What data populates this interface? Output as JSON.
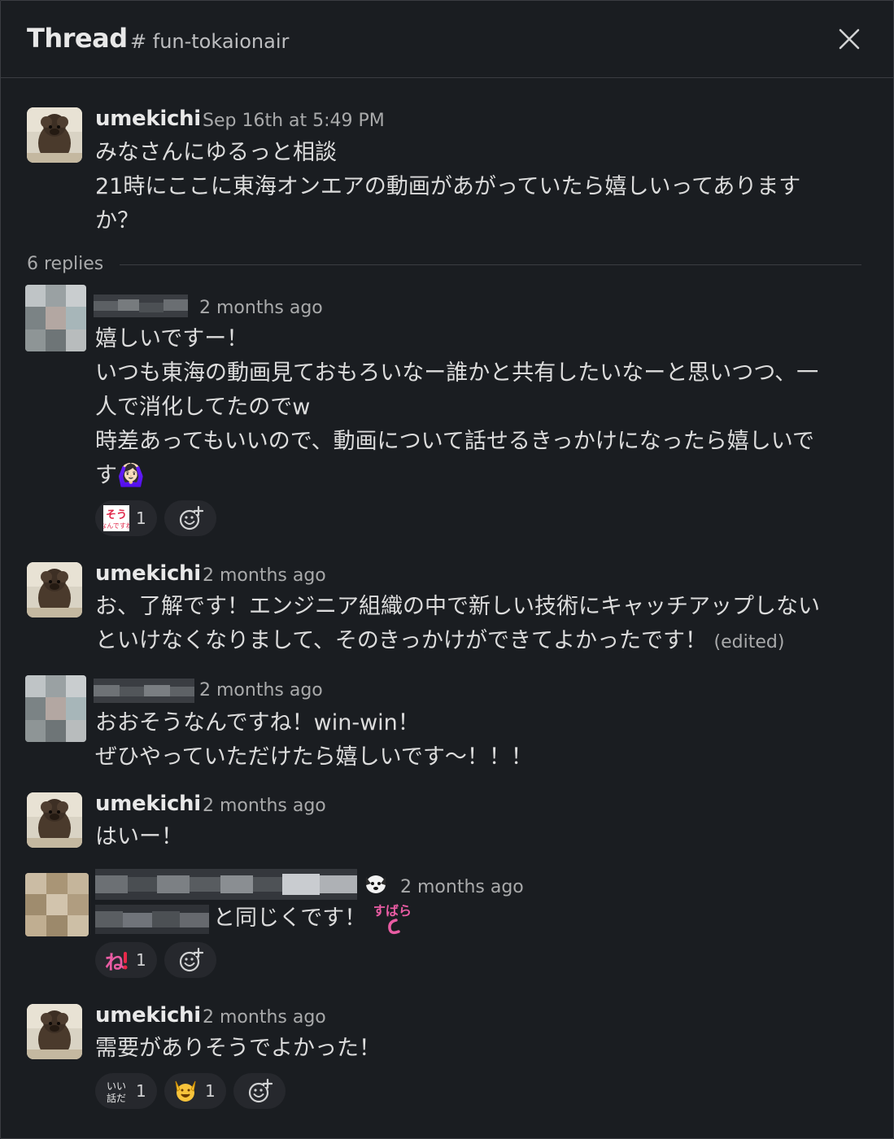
{
  "header": {
    "title": "Thread",
    "channel": "# fun-tokaionair",
    "close_icon": "close-icon"
  },
  "parent": {
    "author": "umekichi",
    "time": "Sep 16th at 5:49 PM",
    "lines": [
      "みなさんにゆるっと相談",
      "21時にここに東海オンエアの動画があがっていたら嬉しいってあります",
      "か？"
    ]
  },
  "replies_label": "6 replies",
  "replies": [
    {
      "author": "",
      "time": "2 months ago",
      "lines": [
        "嬉しいですー！",
        "いつも東海の動画見ておもろいなー誰かと共有したいなーと思いつつ、一",
        "人で消化してたのでw",
        "時差あってもいいので、動画について話せるきっかけになったら嬉しいで",
        "す🙆🏻‍♀️"
      ],
      "reactions": [
        {
          "emoji": "sou-stamp",
          "count": "1"
        }
      ]
    },
    {
      "author": "umekichi",
      "time": "2 months ago",
      "lines": [
        "お、了解です！エンジニア組織の中で新しい技術にキャッチアップしない",
        "といけなくなりまして、そのきっかけができてよかったです！"
      ],
      "edited": "(edited)"
    },
    {
      "author": "",
      "time": "2 months ago",
      "lines": [
        "おおそうなんですね！win-win！",
        "ぜひやっていただけたら嬉しいです〜！！！"
      ]
    },
    {
      "author": "umekichi",
      "time": "2 months ago",
      "lines": [
        "はいー！"
      ]
    },
    {
      "author": "",
      "time": "2 months ago",
      "line_suffix": "と同じくです！",
      "inline_stamp": "すばら",
      "reactions": [
        {
          "emoji": "ne-stamp",
          "count": "1"
        }
      ]
    },
    {
      "author": "umekichi",
      "time": "2 months ago",
      "lines": [
        "需要がありそうでよかった！"
      ],
      "reactions": [
        {
          "emoji": "iihanashi-stamp",
          "count": "1"
        },
        {
          "emoji": "raised-hands-emoji",
          "count": "1"
        }
      ]
    }
  ],
  "colors": {
    "background": "#1a1d21",
    "reaction_bg": "#26282d",
    "divider": "#3b3d42"
  }
}
